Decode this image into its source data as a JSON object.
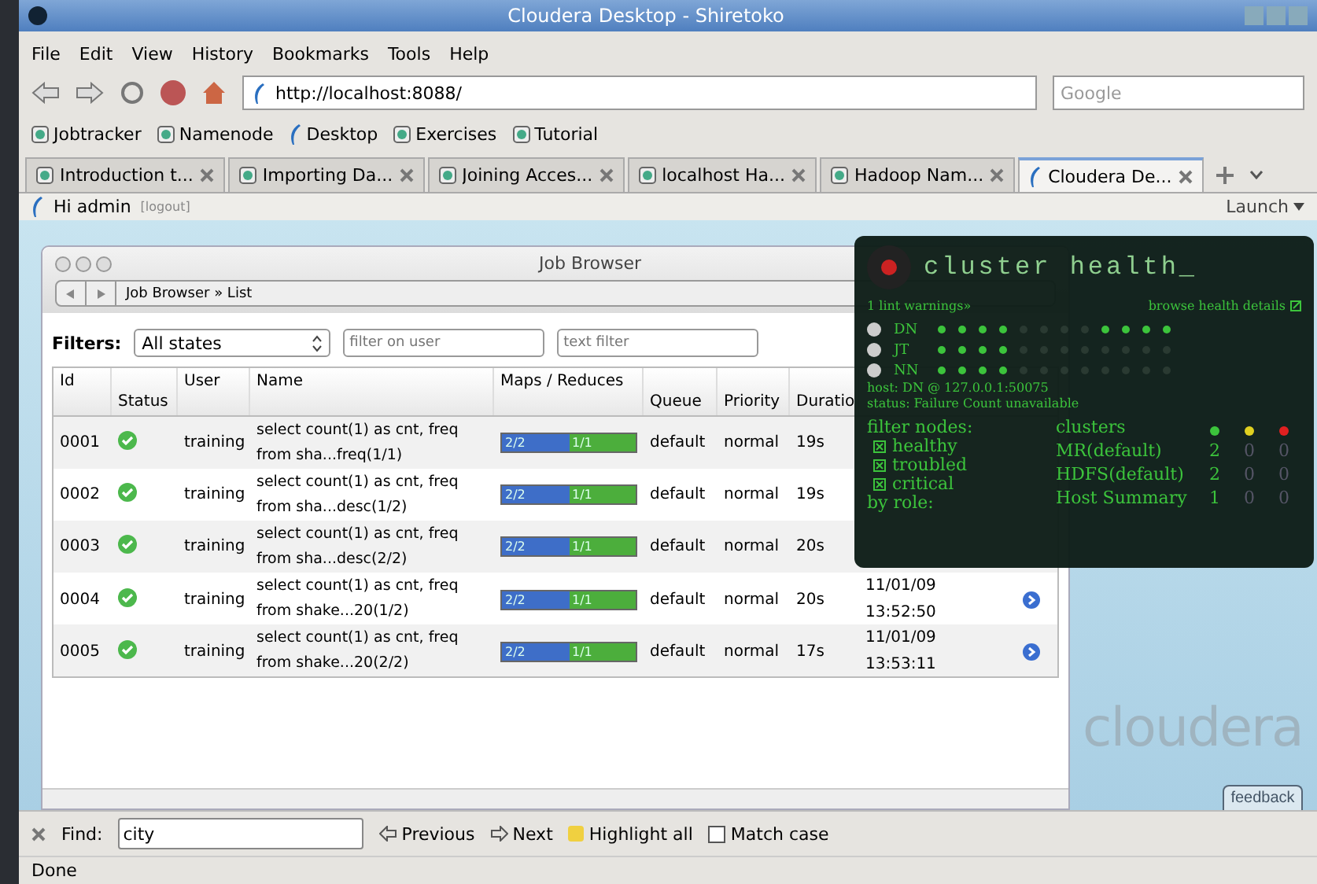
{
  "window": {
    "title": "Cloudera Desktop - Shiretoko"
  },
  "menu": [
    "File",
    "Edit",
    "View",
    "History",
    "Bookmarks",
    "Tools",
    "Help"
  ],
  "address": {
    "value": "http://localhost:8088/"
  },
  "search": {
    "placeholder": "Google"
  },
  "bookmarks": [
    {
      "label": "Jobtracker",
      "kind": "page"
    },
    {
      "label": "Namenode",
      "kind": "page"
    },
    {
      "label": "Desktop",
      "kind": "app"
    },
    {
      "label": "Exercises",
      "kind": "page"
    },
    {
      "label": "Tutorial",
      "kind": "page"
    }
  ],
  "tabs": [
    {
      "label": "Introduction t...",
      "kind": "page",
      "selected": false
    },
    {
      "label": "Importing Da...",
      "kind": "page",
      "selected": false
    },
    {
      "label": "Joining Acces...",
      "kind": "page",
      "selected": false
    },
    {
      "label": "localhost Ha...",
      "kind": "page",
      "selected": false
    },
    {
      "label": "Hadoop Nam...",
      "kind": "page",
      "selected": false
    },
    {
      "label": "Cloudera De...",
      "kind": "app",
      "selected": true
    }
  ],
  "user_bar": {
    "greeting": "Hi admin",
    "logout": "[logout]",
    "launch": "Launch"
  },
  "job_browser": {
    "title": "Job Browser",
    "breadcrumb": "Job Browser » List",
    "filters_label": "Filters:",
    "state_select": "All states",
    "user_filter": {
      "placeholder": "filter on user"
    },
    "text_filter": {
      "placeholder": "text filter"
    },
    "columns": [
      "Id",
      "Status",
      "User",
      "Name",
      "Maps / Reduces",
      "Queue",
      "Priority",
      "Duratio"
    ],
    "rows": [
      {
        "id": "0001",
        "succeeded": true,
        "user": "training",
        "name": "select count(1) as cnt, freq from sha...freq(1/1)",
        "maps": {
          "text": "2/2",
          "level": 1
        },
        "reduces": {
          "text": "1/1",
          "level": 1
        },
        "queue": "default",
        "priority": "normal",
        "duration": "19s"
      },
      {
        "id": "0002",
        "succeeded": true,
        "user": "training",
        "name": "select count(1) as cnt, freq from sha...desc(1/2)",
        "maps": {
          "text": "2/2",
          "level": 1
        },
        "reduces": {
          "text": "1/1",
          "level": 1
        },
        "queue": "default",
        "priority": "normal",
        "duration": "19s"
      },
      {
        "id": "0003",
        "succeeded": true,
        "user": "training",
        "name": "select count(1) as cnt, freq from sha...desc(2/2)",
        "maps": {
          "text": "2/2",
          "level": 1
        },
        "reduces": {
          "text": "1/1",
          "level": 1
        },
        "queue": "default",
        "priority": "normal",
        "duration": "20s"
      },
      {
        "id": "0004",
        "succeeded": true,
        "user": "training",
        "name": "select count(1) as cnt, freq from shake...20(1/2)",
        "maps": {
          "text": "2/2",
          "level": 1
        },
        "reduces": {
          "text": "1/1",
          "level": 1
        },
        "queue": "default",
        "priority": "normal",
        "duration": "20s",
        "date": "11/01/09",
        "time": "13:52:50"
      },
      {
        "id": "0005",
        "succeeded": true,
        "user": "training",
        "name": "select count(1) as cnt, freq from shake...20(2/2)",
        "maps": {
          "text": "2/2",
          "level": 1
        },
        "reduces": {
          "text": "1/1",
          "level": 1
        },
        "queue": "default",
        "priority": "normal",
        "duration": "17s",
        "date": "11/01/09",
        "time": "13:53:11"
      }
    ]
  },
  "health": {
    "title": "cluster health_",
    "lint": "1 lint warnings»",
    "details": "browse health details",
    "nodes": [
      {
        "label": "DN",
        "dots": [
          true,
          true,
          true,
          true,
          false,
          false,
          false,
          false,
          true,
          true,
          true,
          true
        ]
      },
      {
        "label": "JT",
        "dots": [
          true,
          true,
          true,
          true,
          false,
          false,
          false,
          false,
          false,
          false,
          false,
          false
        ]
      },
      {
        "label": "NN",
        "dots": [
          true,
          true,
          true,
          true,
          false,
          false,
          false,
          false,
          false,
          false,
          false,
          false
        ]
      }
    ],
    "host": "host: DN @ 127.0.0.1:50075",
    "status": "status: Failure Count unavailable",
    "filter_label": "filter nodes:",
    "filters": [
      {
        "label": "healthy",
        "checked": true
      },
      {
        "label": "troubled",
        "checked": true
      },
      {
        "label": "critical",
        "checked": true
      }
    ],
    "role_label": "by role:",
    "clusters_label": "clusters",
    "levels": [
      {
        "color": "#3cc43c"
      },
      {
        "color": "#e0d020"
      },
      {
        "color": "#e02020"
      }
    ],
    "clusters": [
      {
        "name": "MR(default)",
        "counts": [
          "2",
          "0",
          "0"
        ]
      },
      {
        "name": "HDFS(default)",
        "counts": [
          "2",
          "0",
          "0"
        ]
      },
      {
        "name": "Host Summary",
        "counts": [
          "1",
          "0",
          "0"
        ]
      }
    ]
  },
  "brand": "cloudera",
  "feedback": "feedback",
  "find_bar": {
    "label": "Find:",
    "value": "city",
    "previous": "Previous",
    "next": "Next",
    "highlight": "Highlight all",
    "match_case": {
      "label": "Match case",
      "checked": false
    }
  },
  "status_bar": "Done"
}
